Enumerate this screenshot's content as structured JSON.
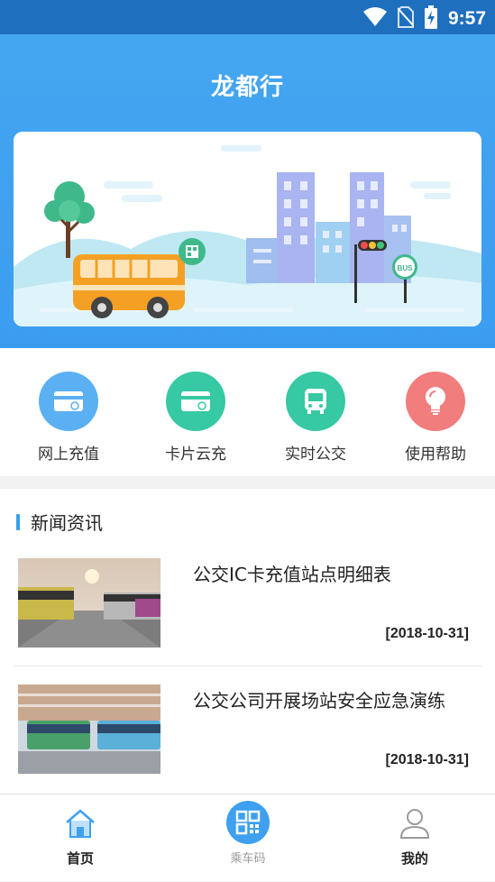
{
  "status": {
    "time": "9:57",
    "icons": [
      "wifi-icon",
      "no-sim-icon",
      "battery-charging-icon"
    ]
  },
  "app": {
    "title": "龙都行"
  },
  "banner": {
    "sign_text": "BUS"
  },
  "quick_actions": [
    {
      "label": "网上充值",
      "icon": "card-icon",
      "color": "#5bb0f3"
    },
    {
      "label": "卡片云充",
      "icon": "card-cloud-icon",
      "color": "#36c9a3"
    },
    {
      "label": "实时公交",
      "icon": "bus-icon",
      "color": "#36c9a3"
    },
    {
      "label": "使用帮助",
      "icon": "lightbulb-icon",
      "color": "#f27d7d"
    }
  ],
  "news": {
    "heading": "新闻资讯",
    "items": [
      {
        "title": "公交IC卡充值站点明细表",
        "date": "[2018-10-31]"
      },
      {
        "title": "公交公司开展场站安全应急演练",
        "date": "[2018-10-31]"
      }
    ]
  },
  "tabbar": {
    "tabs": [
      {
        "label": "首页",
        "icon": "home-icon",
        "active": true
      },
      {
        "label": "乘车码",
        "icon": "qr-code-icon",
        "active": false
      },
      {
        "label": "我的",
        "icon": "person-icon",
        "active": false
      }
    ]
  },
  "colors": {
    "primary": "#3ea0ef",
    "status_bar": "#1f6fbf",
    "news_accent": "#39a0ee"
  }
}
